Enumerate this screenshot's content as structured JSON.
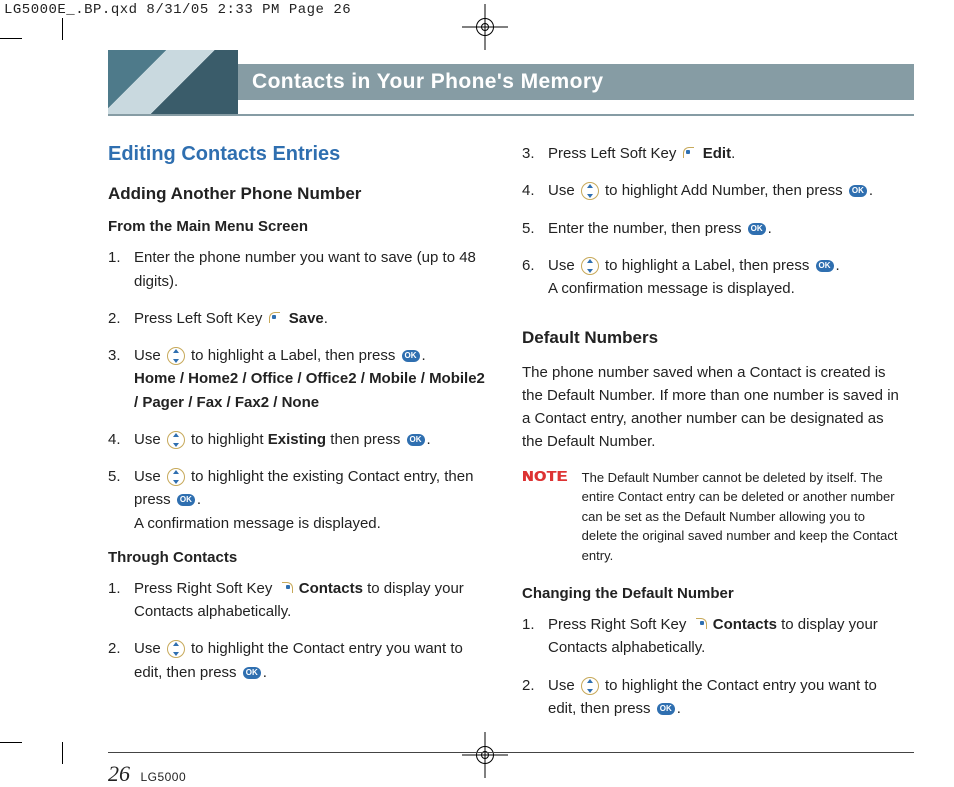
{
  "print": {
    "slug": "LG5000E_.BP.qxd  8/31/05  2:33 PM  Page 26"
  },
  "banner": {
    "title": "Contacts in Your Phone's Memory"
  },
  "left": {
    "h2": "Editing Contacts Entries",
    "h3": "Adding Another Phone Number",
    "h4a": "From the Main Menu Screen",
    "s1": {
      "i1": "Enter the phone number you want to save (up to 48 digits).",
      "i2a": "Press Left Soft Key ",
      "i2b": "Save",
      "i2c": ".",
      "i3a": "Use ",
      "i3b": " to highlight a Label, then press ",
      "i3c": ".",
      "i3opts": "Home / Home2 / Office / Office2 / Mobile / Mobile2 / Pager / Fax / Fax2 / None",
      "i4a": "Use ",
      "i4b": " to highlight ",
      "i4c": "Existing",
      "i4d": " then press ",
      "i4e": ".",
      "i5a": "Use ",
      "i5b": " to highlight the existing Contact entry, then press ",
      "i5c": ".",
      "i5d": "A confirmation message is displayed."
    },
    "h4b": "Through Contacts",
    "s2": {
      "i1a": "Press Right Soft Key ",
      "i1b": "Contacts",
      "i1c": " to display your Contacts alphabetically.",
      "i2a": "Use ",
      "i2b": " to highlight the Contact entry you want to edit, then press ",
      "i2c": "."
    }
  },
  "right": {
    "s1": {
      "i3a": "Press Left Soft Key ",
      "i3b": "Edit",
      "i3c": ".",
      "i4a": "Use ",
      "i4b": " to highlight Add Number, then press ",
      "i4c": ".",
      "i5a": "Enter the number, then press ",
      "i5b": ".",
      "i6a": "Use ",
      "i6b": " to highlight a Label, then press ",
      "i6c": ".",
      "i6d": "A confirmation message is displayed."
    },
    "h3b": "Default Numbers",
    "pb": "The phone number saved when a Contact is created is the Default Number. If more than one number is saved in a Contact entry, another number can be designated as the Default Number.",
    "note_label": "NOTE",
    "note_text": "The Default Number cannot be deleted by itself. The entire Contact entry can be deleted or another number can be set as the Default Number allowing you to delete the original saved number and keep the Contact entry.",
    "h4c": "Changing the Default Number",
    "s3": {
      "i1a": "Press Right Soft Key ",
      "i1b": "Contacts",
      "i1c": " to display your Contacts alphabetically.",
      "i2a": "Use ",
      "i2b": " to highlight the Contact entry you want to edit, then press ",
      "i2c": "."
    }
  },
  "footer": {
    "page": "26",
    "model": "LG5000"
  }
}
